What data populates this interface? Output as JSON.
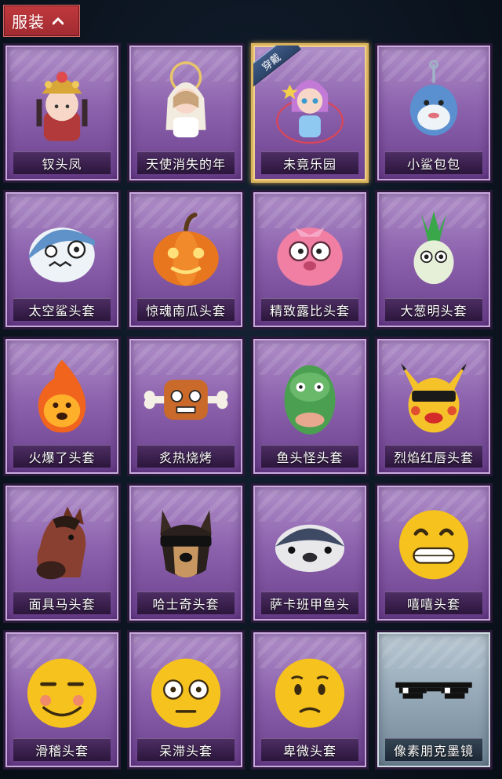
{
  "header": {
    "tab_label": "服装",
    "icon": "chevron-up-icon"
  },
  "items": [
    {
      "name": "钗头凤",
      "icon": "phoenix-crown-doll-icon",
      "equipped": false
    },
    {
      "name": "天使消失的年",
      "icon": "angel-doll-icon",
      "equipped": false
    },
    {
      "name": "未竟乐园",
      "icon": "wonderland-doll-icon",
      "equipped": true,
      "badge": "穿戴"
    },
    {
      "name": "小鲨包包",
      "icon": "shark-bag-icon",
      "equipped": false
    },
    {
      "name": "太空鲨头套",
      "icon": "space-shark-head-icon",
      "equipped": false
    },
    {
      "name": "惊魂南瓜头套",
      "icon": "pumpkin-head-icon",
      "equipped": false
    },
    {
      "name": "精致露比头套",
      "icon": "pink-beaver-head-icon",
      "equipped": false
    },
    {
      "name": "大葱明头套",
      "icon": "scallion-head-icon",
      "equipped": false
    },
    {
      "name": "火爆了头套",
      "icon": "fire-head-icon",
      "equipped": false
    },
    {
      "name": "炙热烧烤",
      "icon": "bbq-meat-head-icon",
      "equipped": false
    },
    {
      "name": "鱼头怪头套",
      "icon": "fish-head-icon",
      "equipped": false
    },
    {
      "name": "烈焰红唇头套",
      "icon": "yellow-mouse-head-icon",
      "equipped": false
    },
    {
      "name": "面具马头套",
      "icon": "horse-mask-icon",
      "equipped": false
    },
    {
      "name": "哈士奇头套",
      "icon": "husky-head-icon",
      "equipped": false
    },
    {
      "name": "萨卡班甲鱼头",
      "icon": "sacabambaspis-head-icon",
      "equipped": false
    },
    {
      "name": "嘻嘻头套",
      "icon": "grinning-emoji-head-icon",
      "equipped": false
    },
    {
      "name": "滑稽头套",
      "icon": "funny-emoji-head-icon",
      "equipped": false
    },
    {
      "name": "呆滞头套",
      "icon": "dazed-emoji-head-icon",
      "equipped": false
    },
    {
      "name": "卑微头套",
      "icon": "humble-emoji-head-icon",
      "equipped": false
    },
    {
      "name": "像素朋克墨镜",
      "icon": "pixel-sunglasses-icon",
      "equipped": false
    }
  ]
}
